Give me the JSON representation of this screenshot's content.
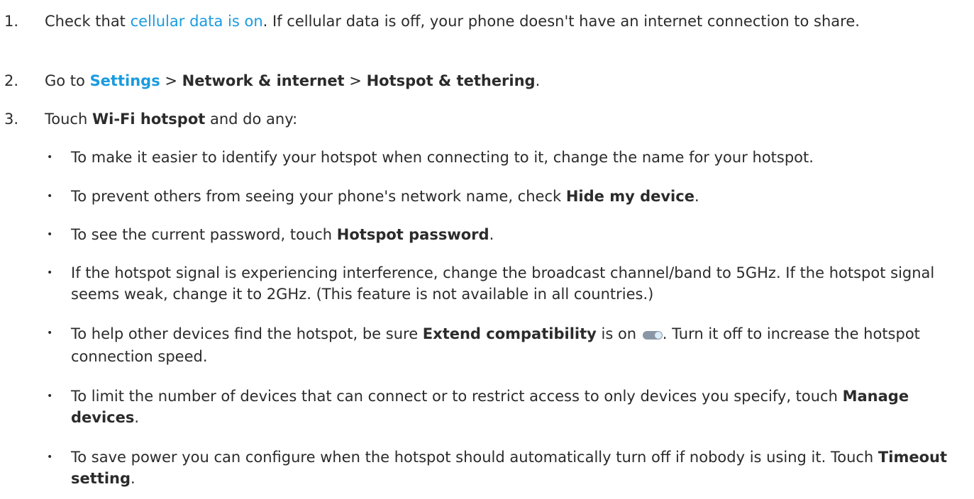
{
  "steps": [
    {
      "num": "1.",
      "pre": "Check that ",
      "link": "cellular data is on",
      "post": ". If cellular data is off, your phone doesn't have an internet connection to share."
    },
    {
      "num": "2.",
      "pre": "Go to ",
      "link": "Settings",
      "sep1": " > ",
      "b1": "Network & internet",
      "sep2": " > ",
      "b2": "Hotspot & tethering",
      "post": "."
    },
    {
      "num": "3.",
      "pre": "Touch ",
      "b1": "Wi-Fi hotspot",
      "post": " and do any:"
    }
  ],
  "bullets": [
    {
      "symbol": "•",
      "text": "To make it easier to identify your hotspot when connecting to it, change the name for your hotspot."
    },
    {
      "symbol": "•",
      "pre": "To prevent others from seeing your phone's network name, check ",
      "bold": "Hide my device",
      "post": "."
    },
    {
      "symbol": "•",
      "pre": "To see the current password, touch ",
      "bold": "Hotspot password",
      "post": "."
    },
    {
      "symbol": "•",
      "text": "If the hotspot signal is experiencing interference, change the broadcast channel/band to 5GHz. If the hotspot signal seems weak, change it to 2GHz. (This feature is not available in all countries.)"
    },
    {
      "symbol": "•",
      "pre": "To help other devices find the hotspot, be sure ",
      "bold": "Extend compatibility",
      "mid": " is on ",
      "post": ". Turn it off to increase the hotspot connection speed.",
      "toggle_on": true
    },
    {
      "symbol": "•",
      "pre": "To limit the number of devices that can connect or to restrict access to only devices you specify, touch ",
      "bold": "Manage devices",
      "post": "."
    },
    {
      "symbol": "•",
      "pre": "To save power you can configure when the hotspot should automatically turn off if nobody is using it. Touch ",
      "bold": "Timeout setting",
      "post": "."
    }
  ],
  "colors": {
    "link": "#1a9bdf",
    "text": "#2b2b2b",
    "toggle_track": "#8a96a5"
  }
}
